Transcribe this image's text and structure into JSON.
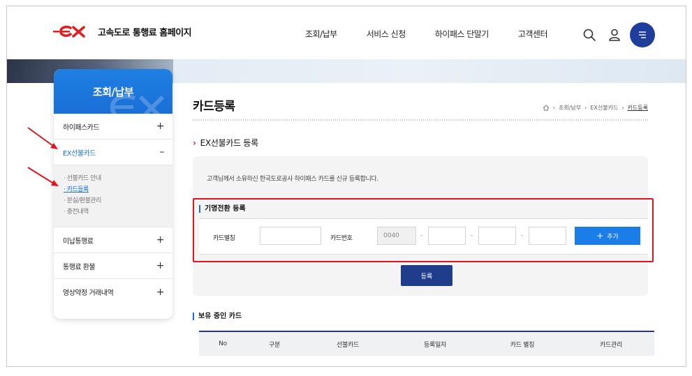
{
  "header": {
    "logo_text": "고속도로 통행료 홈페이지",
    "nav": [
      "조회/납부",
      "서비스 신청",
      "하이패스 단말기",
      "고객센터"
    ],
    "brand_color": "#e02020",
    "menu_button_color": "#1f3d9a"
  },
  "sidebar": {
    "title": "조회/납부",
    "items": [
      {
        "label": "하이패스카드",
        "sign": "+"
      },
      {
        "label": "EX선불카드",
        "sign": "–"
      },
      {
        "label": "미납통행료",
        "sign": "+"
      },
      {
        "label": "통행료 환불",
        "sign": "+"
      },
      {
        "label": "영상약정 거래내역",
        "sign": "+"
      }
    ],
    "sub_items": [
      "· 선불카드 안내",
      "· 카드등록",
      "· 분실/환불관리",
      "· 충전내역"
    ]
  },
  "content": {
    "page_title": "카드등록",
    "breadcrumb": [
      "조회/납부",
      "EX선불카드",
      "카드등록"
    ],
    "section_title": "EX선불카드 등록",
    "notice": "고객님께서 소유하신 한국도로공사 하이패스 카드를 신규 등록합니다.",
    "form_title": "기명전환 등록",
    "card_alias_label": "카드별칭",
    "card_number_label": "카드번호",
    "card_prefix": "0040",
    "dash": "-",
    "add_button": "추가",
    "submit_button": "등록"
  },
  "holdings": {
    "title": "보유 중인 카드",
    "columns": [
      "No",
      "구분",
      "선불카드",
      "등록일자",
      "카드 별칭",
      "카드관리"
    ]
  }
}
